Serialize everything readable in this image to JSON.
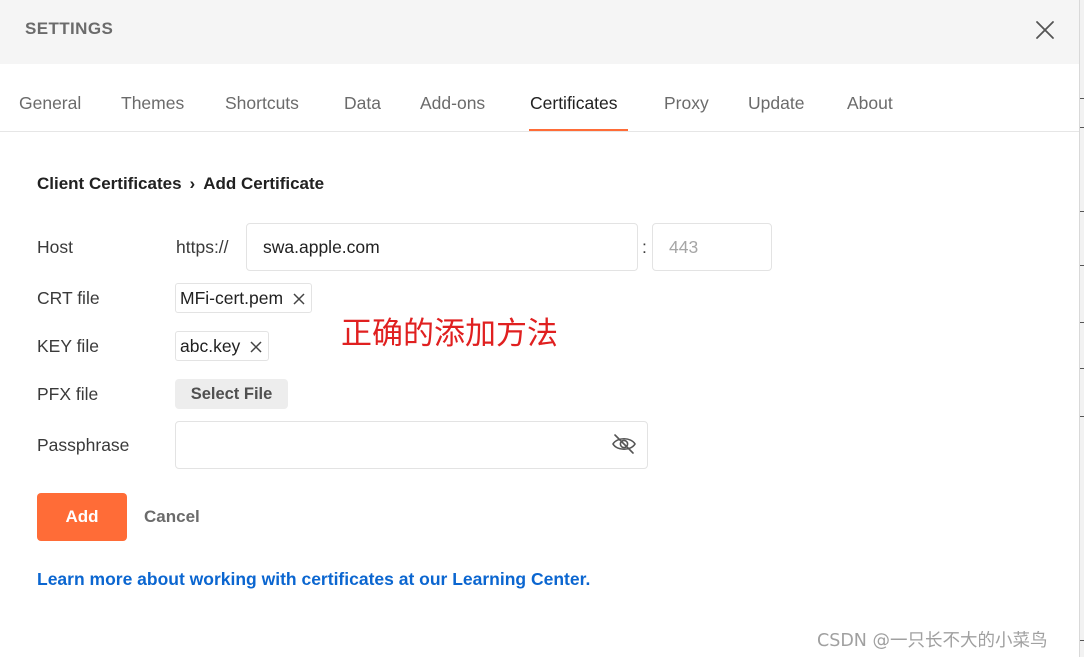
{
  "dialog": {
    "title": "SETTINGS"
  },
  "tabs": [
    {
      "label": "General"
    },
    {
      "label": "Themes"
    },
    {
      "label": "Shortcuts"
    },
    {
      "label": "Data"
    },
    {
      "label": "Add-ons"
    },
    {
      "label": "Certificates"
    },
    {
      "label": "Proxy"
    },
    {
      "label": "Update"
    },
    {
      "label": "About"
    }
  ],
  "active_tab": "Certificates",
  "breadcrumb": {
    "parent": "Client Certificates",
    "separator": "›",
    "current": "Add Certificate"
  },
  "form": {
    "host": {
      "label": "Host",
      "prefix": "https://",
      "value": "swa.apple.com",
      "port_separator": ":",
      "port_placeholder": "443"
    },
    "crt": {
      "label": "CRT file",
      "file": "MFi-cert.pem"
    },
    "key": {
      "label": "KEY file",
      "file": "abc.key"
    },
    "pfx": {
      "label": "PFX file",
      "button": "Select File"
    },
    "passphrase": {
      "label": "Passphrase",
      "value": ""
    }
  },
  "actions": {
    "add": "Add",
    "cancel": "Cancel"
  },
  "learn_more": "Learn more about working with certificates at our Learning Center.",
  "annotation": "正确的添加方法",
  "watermark": "CSDN @一只长不大的小菜鸟",
  "colors": {
    "accent": "#ff6c37",
    "link": "#0b66d0",
    "annotation": "#e02020"
  },
  "icons": {
    "close": "close-icon",
    "chip_remove": "x-icon",
    "password_visibility": "eye-off-icon"
  }
}
